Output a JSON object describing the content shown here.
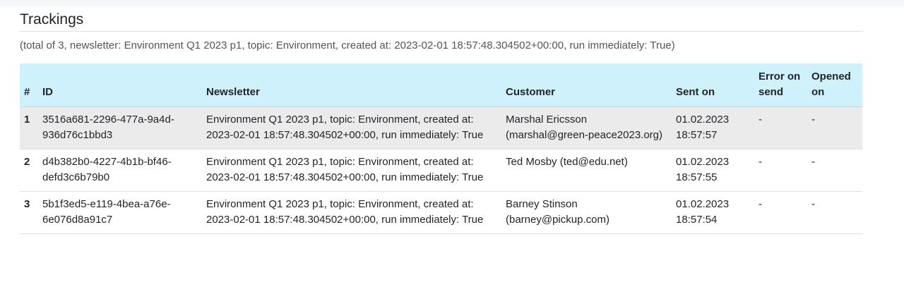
{
  "page": {
    "title": "Trackings",
    "subtitle": "(total of 3, newsletter: Environment Q1 2023 p1, topic: Environment, created at: 2023-02-01 18:57:48.304502+00:00, run immediately: True)"
  },
  "table": {
    "headers": {
      "num": "#",
      "id": "ID",
      "newsletter": "Newsletter",
      "customer": "Customer",
      "sent_on": "Sent on",
      "error_on_send": "Error on send",
      "opened_on": "Opened on"
    },
    "rows": [
      {
        "num": "1",
        "id": "3516a681-2296-477a-9a4d-936d76c1bbd3",
        "newsletter": "Environment Q1 2023 p1, topic: Environment, created at: 2023-02-01 18:57:48.304502+00:00, run immediately: True",
        "customer": "Marshal Ericsson (marshal@green-peace2023.org)",
        "sent_on": "01.02.2023 18:57:57",
        "error_on_send": "-",
        "opened_on": "-"
      },
      {
        "num": "2",
        "id": "d4b382b0-4227-4b1b-bf46-defd3c6b79b0",
        "newsletter": "Environment Q1 2023 p1, topic: Environment, created at: 2023-02-01 18:57:48.304502+00:00, run immediately: True",
        "customer": "Ted Mosby (ted@edu.net)",
        "sent_on": "01.02.2023 18:57:55",
        "error_on_send": "-",
        "opened_on": "-"
      },
      {
        "num": "3",
        "id": "5b1f3ed5-e119-4bea-a76e-6e076d8a91c7",
        "newsletter": "Environment Q1 2023 p1, topic: Environment, created at: 2023-02-01 18:57:48.304502+00:00, run immediately: True",
        "customer": "Barney Stinson (barney@pickup.com)",
        "sent_on": "01.02.2023 18:57:54",
        "error_on_send": "-",
        "opened_on": "-"
      }
    ]
  }
}
